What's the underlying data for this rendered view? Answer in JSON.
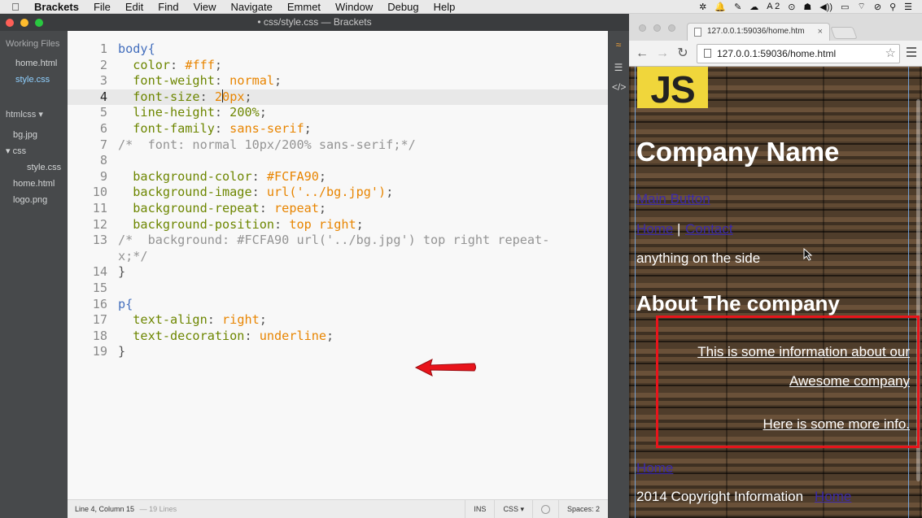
{
  "menubar": {
    "items": [
      "Brackets",
      "File",
      "Edit",
      "Find",
      "View",
      "Navigate",
      "Emmet",
      "Window",
      "Debug",
      "Help"
    ],
    "tray": [
      "✲",
      "🔔",
      "✎",
      "☁",
      "A 2",
      "⊙",
      "☗",
      "◀))",
      "▭",
      "⌔",
      "⊘",
      "⚲",
      "☰"
    ]
  },
  "brackets": {
    "title": "• css/style.css — Brackets",
    "sidebar": {
      "working_files_label": "Working Files",
      "working_files": [
        "home.html",
        "style.css"
      ],
      "project_label": "htmlcss ▾",
      "tree": [
        {
          "name": "bg.jpg",
          "indent": 0
        },
        {
          "name": "▾ css",
          "indent": 0
        },
        {
          "name": "style.css",
          "indent": 1
        },
        {
          "name": "home.html",
          "indent": 0
        },
        {
          "name": "logo.png",
          "indent": 0
        }
      ]
    },
    "code_lines": [
      {
        "n": "1",
        "segs": [
          [
            "sel",
            "body{"
          ]
        ]
      },
      {
        "n": "2",
        "segs": [
          [
            "prop",
            "  color"
          ],
          [
            "",
            ": "
          ],
          [
            "val",
            "#fff"
          ],
          [
            "",
            ";"
          ]
        ]
      },
      {
        "n": "3",
        "segs": [
          [
            "prop",
            "  font-weight"
          ],
          [
            "",
            ": "
          ],
          [
            "val",
            "normal"
          ],
          [
            "",
            ";"
          ]
        ]
      },
      {
        "n": "4",
        "active": true,
        "segs": [
          [
            "prop",
            "  font-size"
          ],
          [
            "",
            ": "
          ],
          [
            "val",
            "2"
          ],
          [
            "cursor",
            ""
          ],
          [
            "val",
            "0px"
          ],
          [
            "",
            ";"
          ]
        ]
      },
      {
        "n": "5",
        "segs": [
          [
            "prop",
            "  line-height"
          ],
          [
            "",
            ": "
          ],
          [
            "prop",
            "200%"
          ],
          [
            "",
            ";"
          ]
        ]
      },
      {
        "n": "6",
        "segs": [
          [
            "prop",
            "  font-family"
          ],
          [
            "",
            ": "
          ],
          [
            "val",
            "sans-serif"
          ],
          [
            "",
            ";"
          ]
        ]
      },
      {
        "n": "7",
        "segs": [
          [
            "cmt",
            "/*  font: normal 10px/200% sans-serif;*/"
          ]
        ]
      },
      {
        "n": "8",
        "segs": []
      },
      {
        "n": "9",
        "segs": [
          [
            "prop",
            "  background-color"
          ],
          [
            "",
            ": "
          ],
          [
            "val",
            "#FCFA90"
          ],
          [
            "",
            ";"
          ]
        ]
      },
      {
        "n": "10",
        "segs": [
          [
            "prop",
            "  background-image"
          ],
          [
            "",
            ": "
          ],
          [
            "val",
            "url('../bg.jpg')"
          ],
          [
            "",
            ";"
          ]
        ]
      },
      {
        "n": "11",
        "segs": [
          [
            "prop",
            "  background-repeat"
          ],
          [
            "",
            ": "
          ],
          [
            "val",
            "repeat"
          ],
          [
            "",
            ";"
          ]
        ]
      },
      {
        "n": "12",
        "segs": [
          [
            "prop",
            "  background-position"
          ],
          [
            "",
            ": "
          ],
          [
            "val",
            "top right"
          ],
          [
            "",
            ";"
          ]
        ]
      },
      {
        "n": "13",
        "segs": [
          [
            "cmt",
            "/*  background: #FCFA90 url('../bg.jpg') top right repeat-"
          ]
        ]
      },
      {
        "n": "",
        "segs": [
          [
            "cmt",
            "x;*/"
          ]
        ]
      },
      {
        "n": "14",
        "segs": [
          [
            "",
            "}"
          ]
        ]
      },
      {
        "n": "15",
        "segs": []
      },
      {
        "n": "16",
        "segs": [
          [
            "sel",
            "p{"
          ]
        ]
      },
      {
        "n": "17",
        "segs": [
          [
            "prop",
            "  text-align"
          ],
          [
            "",
            ": "
          ],
          [
            "val",
            "right"
          ],
          [
            "",
            ";"
          ]
        ]
      },
      {
        "n": "18",
        "segs": [
          [
            "prop",
            "  text-decoration"
          ],
          [
            "",
            ": "
          ],
          [
            "val",
            "underline"
          ],
          [
            "",
            ";"
          ]
        ]
      },
      {
        "n": "19",
        "segs": [
          [
            "",
            "}"
          ]
        ]
      }
    ],
    "status": {
      "position": "Line 4, Column 15",
      "lines": "— 19 Lines",
      "mode": "INS",
      "language": "CSS ▾",
      "spaces": "Spaces: 2"
    }
  },
  "chrome": {
    "tab_title": "127.0.0.1:59036/home.htm",
    "tab_close": "×",
    "url": "127.0.0.1:59036/home.html",
    "page": {
      "logo_text": "JS",
      "company_name": "Company Name",
      "main_button": "Main Button",
      "nav_home": "Home",
      "nav_sep": "|",
      "nav_contact": "Contact",
      "side_text": "anything on the side",
      "about_heading": "About The company",
      "para1_line1": "This is some information about our",
      "para1_line2": "Awesome company",
      "para2": "Here is some more info.",
      "footer_home": "Home",
      "copyright": "2014 Copyright Information",
      "footer_link": "Home"
    }
  },
  "colors": {
    "annotation_red": "#e8141b",
    "logo_yellow": "#f0d63b",
    "link": "#3b2aa8"
  }
}
